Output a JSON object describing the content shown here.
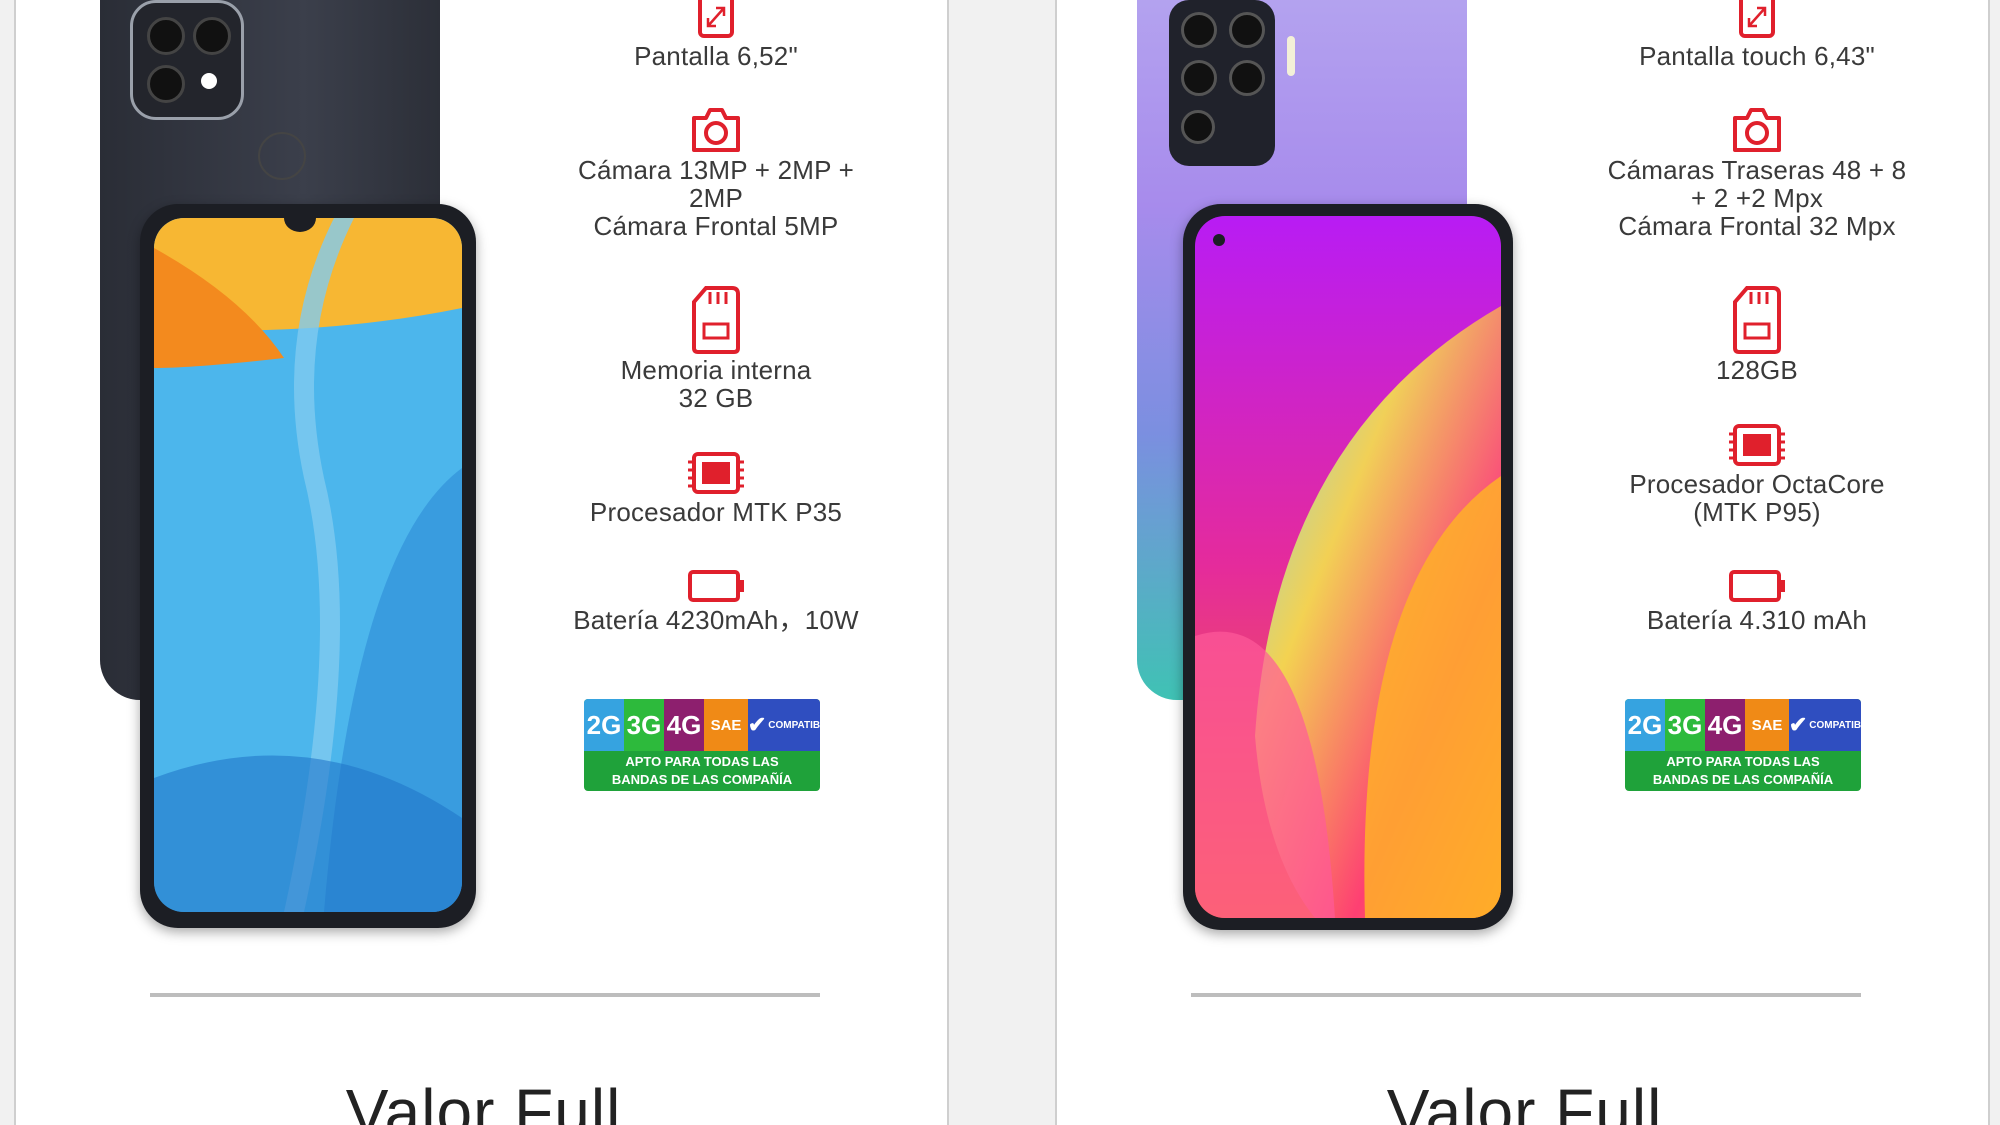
{
  "colors": {
    "accent": "#e0202c",
    "divider": "#bdbdbd",
    "badge_green": "#1fa23a"
  },
  "products": [
    {
      "specs": [
        {
          "icon": "screen-resize-icon",
          "text": "Pantalla 6,52\""
        },
        {
          "icon": "camera-icon",
          "text": "Cámara 13MP + 2MP +\n2MP\nCámara Frontal 5MP"
        },
        {
          "icon": "memory-card-icon",
          "text": "Memoria interna\n32 GB"
        },
        {
          "icon": "processor-chip-icon",
          "text": "Procesador MTK P35"
        },
        {
          "icon": "battery-icon",
          "text": "Batería 4230mAh，10W"
        }
      ],
      "badge": {
        "cells": [
          "2G",
          "3G",
          "4G",
          "SAE",
          "COMPATIB"
        ],
        "caption": "APTO PARA TODAS LAS\nBANDAS DE LAS COMPAÑÍA"
      },
      "price_label": "Valor Full"
    },
    {
      "specs": [
        {
          "icon": "screen-resize-icon",
          "text": "Pantalla touch 6,43\""
        },
        {
          "icon": "camera-icon",
          "text": "Cámaras Traseras 48 + 8\n+ 2 +2 Mpx\nCámara Frontal 32 Mpx"
        },
        {
          "icon": "memory-card-icon",
          "text": "128GB"
        },
        {
          "icon": "processor-chip-icon",
          "text": "Procesador OctaCore\n(MTK P95)"
        },
        {
          "icon": "battery-icon",
          "text": "Batería 4.310 mAh"
        }
      ],
      "badge": {
        "cells": [
          "2G",
          "3G",
          "4G",
          "SAE",
          "COMPATIB"
        ],
        "caption": "APTO PARA TODAS LAS\nBANDAS DE LAS COMPAÑÍA"
      },
      "price_label": "Valor Full"
    }
  ]
}
